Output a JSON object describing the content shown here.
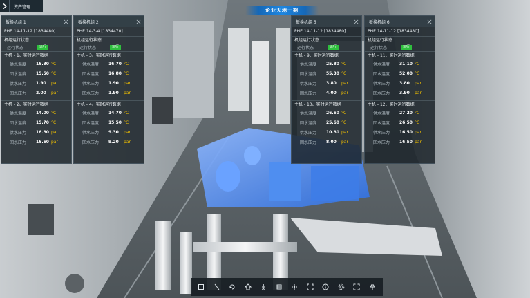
{
  "header": {
    "back_label": "资产管理",
    "title": "企业天地一期"
  },
  "panels": [
    {
      "title": "板换机组 1",
      "device_id": "PHE 14-11-12 [1834480]",
      "status_section": "机组运行状态",
      "status_label": "运行状态",
      "status_value": "运行",
      "groups": [
        {
          "title": "主机 - 1、实时运行数据",
          "rows": [
            {
              "label": "供水温度",
              "value": "16.30",
              "unit": "°C"
            },
            {
              "label": "回水温度",
              "value": "15.50",
              "unit": "°C"
            },
            {
              "label": "供水压力",
              "value": "1.90",
              "unit": "par"
            },
            {
              "label": "回水压力",
              "value": "2.00",
              "unit": "par"
            }
          ]
        },
        {
          "title": "主机 - 2、实时运行数据",
          "rows": [
            {
              "label": "供水温度",
              "value": "14.00",
              "unit": "°C"
            },
            {
              "label": "回水温度",
              "value": "15.70",
              "unit": "°C"
            },
            {
              "label": "供水压力",
              "value": "16.80",
              "unit": "par"
            },
            {
              "label": "回水压力",
              "value": "16.50",
              "unit": "par"
            }
          ]
        }
      ]
    },
    {
      "title": "板换机组 2",
      "device_id": "PHE 14-3-4 [1834470]",
      "status_section": "机组运行状态",
      "status_label": "运行状态",
      "status_value": "运行",
      "groups": [
        {
          "title": "主机 - 3、实时运行数据",
          "rows": [
            {
              "label": "供水温度",
              "value": "16.70",
              "unit": "°C"
            },
            {
              "label": "回水温度",
              "value": "16.80",
              "unit": "°C"
            },
            {
              "label": "供水压力",
              "value": "1.90",
              "unit": "par"
            },
            {
              "label": "回水压力",
              "value": "1.90",
              "unit": "par"
            }
          ]
        },
        {
          "title": "主机 - 4、实时运行数据",
          "rows": [
            {
              "label": "供水温度",
              "value": "14.70",
              "unit": "°C"
            },
            {
              "label": "回水温度",
              "value": "15.50",
              "unit": "°C"
            },
            {
              "label": "供水压力",
              "value": "9.30",
              "unit": "par"
            },
            {
              "label": "回水压力",
              "value": "9.20",
              "unit": "par"
            }
          ]
        }
      ]
    },
    {
      "title": "板换机组 5",
      "device_id": "PHE 14-11-12 [1834480]",
      "status_section": "机组运行状态",
      "status_label": "运行状态",
      "status_value": "运行",
      "groups": [
        {
          "title": "主机 - 9、实时运行数据",
          "rows": [
            {
              "label": "供水温度",
              "value": "25.80",
              "unit": "°C"
            },
            {
              "label": "回水温度",
              "value": "55.30",
              "unit": "°C"
            },
            {
              "label": "供水压力",
              "value": "3.80",
              "unit": "par"
            },
            {
              "label": "回水压力",
              "value": "4.00",
              "unit": "par"
            }
          ]
        },
        {
          "title": "主机 - 10、实时运行数据",
          "rows": [
            {
              "label": "供水温度",
              "value": "26.50",
              "unit": "°C"
            },
            {
              "label": "回水温度",
              "value": "25.60",
              "unit": "°C"
            },
            {
              "label": "供水压力",
              "value": "10.80",
              "unit": "par"
            },
            {
              "label": "回水压力",
              "value": "8.00",
              "unit": "par"
            }
          ]
        }
      ]
    },
    {
      "title": "板换机组 6",
      "device_id": "PHE 14-11-12 [1834480]",
      "status_section": "机组运行状态",
      "status_label": "运行状态",
      "status_value": "运行",
      "groups": [
        {
          "title": "主机 - 11、实时运行数据",
          "rows": [
            {
              "label": "供水温度",
              "value": "31.10",
              "unit": "°C"
            },
            {
              "label": "回水温度",
              "value": "52.00",
              "unit": "°C"
            },
            {
              "label": "供水压力",
              "value": "3.80",
              "unit": "par"
            },
            {
              "label": "回水压力",
              "value": "3.90",
              "unit": "par"
            }
          ]
        },
        {
          "title": "主机 - 12、实时运行数据",
          "rows": [
            {
              "label": "供水温度",
              "value": "27.20",
              "unit": "°C"
            },
            {
              "label": "回水温度",
              "value": "26.50",
              "unit": "°C"
            },
            {
              "label": "供水压力",
              "value": "16.50",
              "unit": "par"
            },
            {
              "label": "回水压力",
              "value": "16.50",
              "unit": "par"
            }
          ]
        }
      ]
    }
  ],
  "toolbar": {
    "tools": [
      {
        "name": "area-icon"
      },
      {
        "name": "ruler-icon"
      },
      {
        "name": "rotate-icon"
      },
      {
        "name": "roam-icon"
      },
      {
        "name": "walk-icon"
      },
      {
        "name": "section-icon"
      },
      {
        "name": "explode-icon"
      },
      {
        "name": "fit-view-icon"
      },
      {
        "name": "info-icon"
      },
      {
        "name": "settings-icon"
      },
      {
        "name": "fullscreen-icon"
      },
      {
        "name": "pin-icon"
      }
    ]
  },
  "colors": {
    "accent_blue": "#1e86e0",
    "status_green": "#2fbf3e",
    "unit_yellow": "#f2c100",
    "panel_bg": "#1c242a"
  }
}
